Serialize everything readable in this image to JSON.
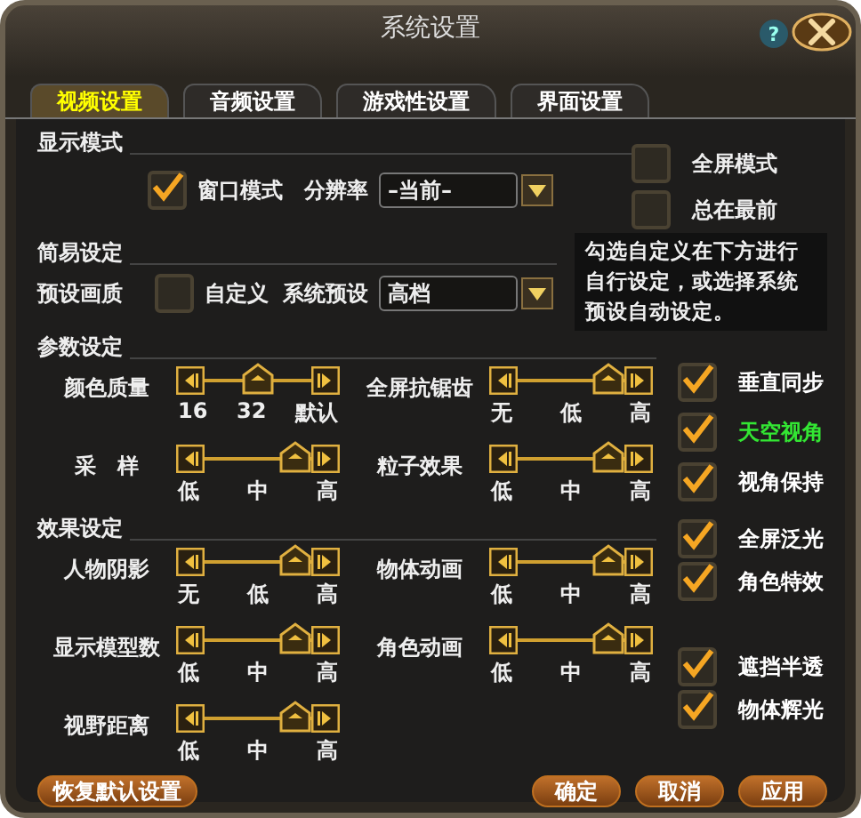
{
  "window": {
    "title": "系统设置",
    "help": "?"
  },
  "tabs": [
    {
      "label": "视频设置",
      "selected": true
    },
    {
      "label": "音频设置",
      "selected": false
    },
    {
      "label": "游戏性设置",
      "selected": false
    },
    {
      "label": "界面设置",
      "selected": false
    }
  ],
  "display_mode": {
    "heading": "显示模式",
    "window_mode": {
      "label": "窗口模式",
      "checked": true
    },
    "resolution_label": "分辨率",
    "resolution_value": "–当前–",
    "options": [
      {
        "label": "全屏模式",
        "checked": false
      },
      {
        "label": "总在最前",
        "checked": false
      }
    ]
  },
  "simple": {
    "heading": "简易设定",
    "preset_label": "预设画质",
    "custom": {
      "label": "自定义",
      "checked": false
    },
    "system_preset_label": "系统预设",
    "system_preset_value": "高档",
    "hint": "勾选自定义在下方进行自行设定，或选择系统预设自动设定。"
  },
  "params": {
    "heading": "参数设定",
    "sliders": [
      {
        "label": "颜色质量",
        "level": 0.5,
        "ticks": [
          "16",
          "32",
          "默认"
        ]
      },
      {
        "label": "全屏抗锯齿",
        "level": 1,
        "ticks": [
          "无",
          "低",
          "高"
        ]
      },
      {
        "label": "采　样",
        "level": 1,
        "ticks": [
          "低",
          "中",
          "高"
        ]
      },
      {
        "label": "粒子效果",
        "level": 1,
        "ticks": [
          "低",
          "中",
          "高"
        ]
      }
    ]
  },
  "effects": {
    "heading": "效果设定",
    "sliders": [
      {
        "label": "人物阴影",
        "level": 1,
        "ticks": [
          "无",
          "低",
          "高"
        ]
      },
      {
        "label": "物体动画",
        "level": 1,
        "ticks": [
          "低",
          "中",
          "高"
        ]
      },
      {
        "label": "显示模型数",
        "level": 1,
        "ticks": [
          "低",
          "中",
          "高"
        ]
      },
      {
        "label": "角色动画",
        "level": 1,
        "ticks": [
          "低",
          "中",
          "高"
        ]
      },
      {
        "label": "视野距离",
        "level": 1,
        "ticks": [
          "低",
          "中",
          "高"
        ]
      }
    ]
  },
  "check_groups": [
    [
      {
        "label": "垂直同步",
        "checked": true,
        "color": "#ffffff"
      },
      {
        "label": "天空视角",
        "checked": true,
        "color": "#33e633"
      },
      {
        "label": "视角保持",
        "checked": true,
        "color": "#ffffff"
      }
    ],
    [
      {
        "label": "全屏泛光",
        "checked": true,
        "color": "#ffffff"
      },
      {
        "label": "角色特效",
        "checked": true,
        "color": "#ffffff"
      }
    ],
    [
      {
        "label": "遮挡半透",
        "checked": true,
        "color": "#ffffff"
      },
      {
        "label": "物体辉光",
        "checked": true,
        "color": "#ffffff"
      }
    ]
  ],
  "buttons": {
    "reset": "恢复默认设置",
    "actions": [
      "确定",
      "取消",
      "应用"
    ]
  }
}
